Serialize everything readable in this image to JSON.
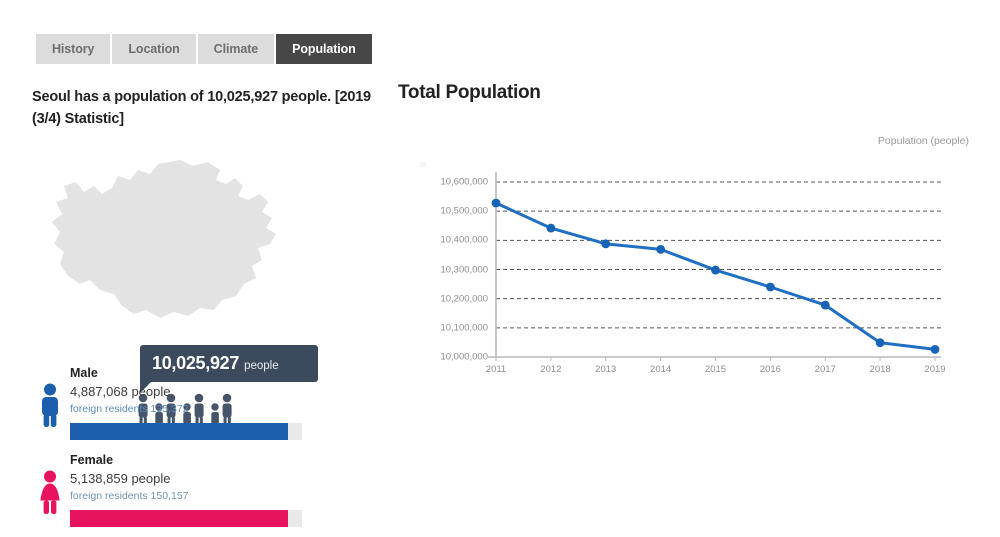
{
  "tabs": [
    {
      "label": "History",
      "active": false
    },
    {
      "label": "Location",
      "active": false
    },
    {
      "label": "Climate",
      "active": false
    },
    {
      "label": "Population",
      "active": true
    }
  ],
  "headline": "Seoul has a population of 10,025,927 people. [2019 (3/4) Statistic]",
  "infographic": {
    "bubble_value": "10,025,927",
    "bubble_unit": "people",
    "map_icon": "seoul-map-silhouette",
    "people_icon": "people-group-icon",
    "people_count": 7
  },
  "gender": {
    "male": {
      "name": "Male",
      "count": "4,887,068 people",
      "foreign": "foreign residents 135,372",
      "icon": "male-person-icon",
      "color": "#1b5fad",
      "bar_pct": 94
    },
    "female": {
      "name": "Female",
      "count": "5,138,859 people",
      "foreign": "foreign residents 150,157",
      "icon": "female-person-icon",
      "color": "#e8135f",
      "bar_pct": 94
    }
  },
  "chart": {
    "title": "Total Population",
    "axis_note": "Population (people)"
  },
  "chart_data": {
    "type": "line",
    "title": "Total Population",
    "xlabel": "",
    "ylabel": "Population (people)",
    "ylim": [
      10000000,
      10600000
    ],
    "ytick_step": 100000,
    "ytick_labels": [
      "10,600,000",
      "10,500,000",
      "10,400,000",
      "10,300,000",
      "10,200,000",
      "10,100,000",
      "10,000,000"
    ],
    "yticks": [
      10600000,
      10500000,
      10400000,
      10300000,
      10200000,
      10100000,
      10000000
    ],
    "categories": [
      "2011",
      "2012",
      "2013",
      "2014",
      "2015",
      "2016",
      "2017",
      "2018",
      "2019"
    ],
    "x": [
      2011,
      2012,
      2013,
      2014,
      2015,
      2016,
      2017,
      2018,
      2019
    ],
    "values": [
      10528000,
      10442000,
      10388000,
      10369000,
      10298000,
      10240000,
      10178000,
      10049000,
      10026000
    ],
    "grid": true,
    "grid_style": "dashed-horizontal",
    "legend": null,
    "line_color": "#1f6fc4",
    "marker": "circle",
    "marker_color": "#1763b5"
  }
}
